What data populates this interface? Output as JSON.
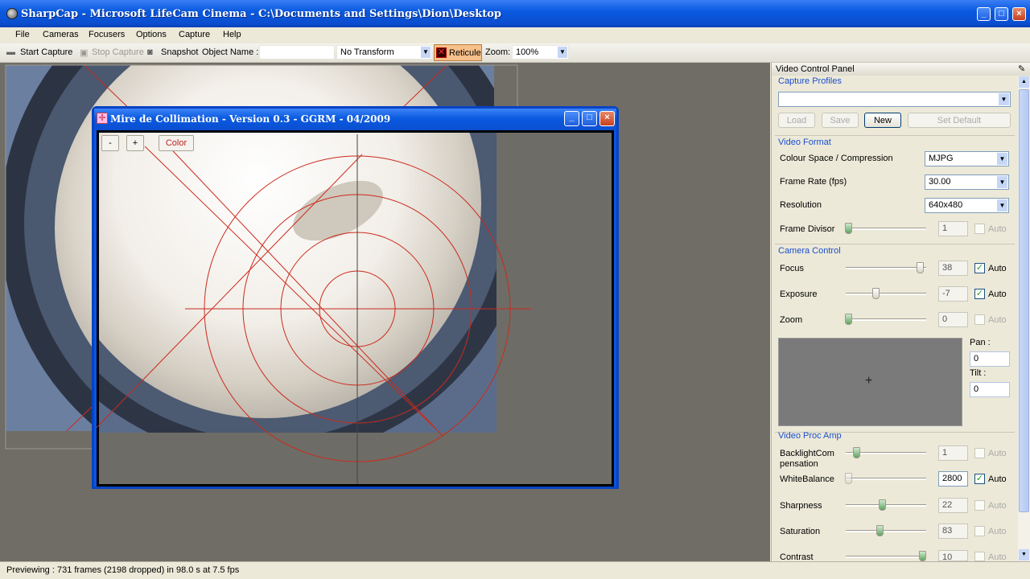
{
  "window": {
    "title": "SharpCap - Microsoft LifeCam Cinema - C:\\Documents and Settings\\Dion\\Desktop"
  },
  "menu": [
    "File",
    "Cameras",
    "Focusers",
    "Options",
    "Capture",
    "Help"
  ],
  "toolbar": {
    "start_capture": "Start Capture",
    "stop_capture": "Stop Capture",
    "snapshot": "Snapshot",
    "object_name_label": "Object Name :",
    "object_name_value": "",
    "transform": "No Transform",
    "reticule": "Reticule",
    "zoom_label": "Zoom:",
    "zoom_value": "100%"
  },
  "dialog": {
    "title": "Mire de Collimation - Version 0.3 - GGRM - 04/2009",
    "minus": "-",
    "plus": "+",
    "color": "Color"
  },
  "panel": {
    "title": "Video Control Panel",
    "capture_profiles": {
      "header": "Capture Profiles",
      "value": "",
      "load": "Load",
      "save": "Save",
      "new": "New",
      "set_default": "Set Default"
    },
    "video_format": {
      "header": "Video Format",
      "colour_label": "Colour Space / Compression",
      "colour_value": "MJPG",
      "fps_label": "Frame Rate (fps)",
      "fps_value": "30.00",
      "res_label": "Resolution",
      "res_value": "640x480",
      "divisor_label": "Frame Divisor",
      "divisor_value": "1",
      "auto": "Auto"
    },
    "camera_control": {
      "header": "Camera Control",
      "focus_label": "Focus",
      "focus_value": "38",
      "exposure_label": "Exposure",
      "exposure_value": "-7",
      "zoom_label": "Zoom",
      "zoom_value": "0",
      "pan_label": "Pan :",
      "pan_value": "0",
      "tilt_label": "Tilt :",
      "tilt_value": "0",
      "auto": "Auto"
    },
    "proc_amp": {
      "header": "Video Proc Amp",
      "backlight_label1": "BacklightCom",
      "backlight_label2": "pensation",
      "backlight_value": "1",
      "wb_label": "WhiteBalance",
      "wb_value": "2800",
      "sharp_label": "Sharpness",
      "sharp_value": "22",
      "sat_label": "Saturation",
      "sat_value": "83",
      "contrast_label": "Contrast",
      "contrast_value": "10",
      "auto": "Auto"
    }
  },
  "status": "Previewing : 731 frames (2198 dropped) in 98.0 s at 7.5 fps"
}
